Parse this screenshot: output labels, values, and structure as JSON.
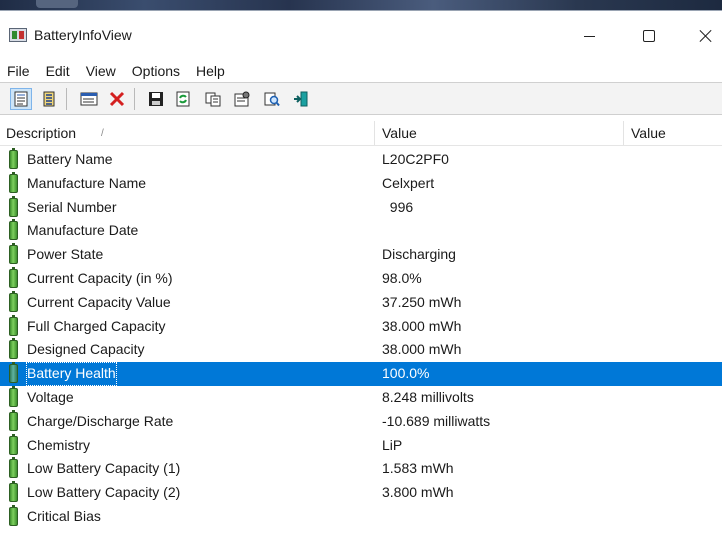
{
  "window": {
    "title": "BatteryInfoView",
    "icon": "battery-info-app-icon"
  },
  "menu": [
    "File",
    "Edit",
    "View",
    "Options",
    "Help"
  ],
  "toolbar": {
    "buttons": [
      "html-report-icon",
      "text-report-icon",
      "properties-window-icon",
      "delete-icon",
      "save-icon",
      "refresh-icon",
      "copy-icon",
      "properties-icon",
      "find-icon",
      "exit-icon"
    ]
  },
  "table": {
    "columns": [
      "Description",
      "Value",
      "Value"
    ],
    "sort_indicator": "/",
    "rows": [
      {
        "desc": "Battery Name",
        "value": "L20C2PF0"
      },
      {
        "desc": "Manufacture Name",
        "value": "Celxpert"
      },
      {
        "desc": "Serial Number",
        "value": "  996"
      },
      {
        "desc": "Manufacture Date",
        "value": ""
      },
      {
        "desc": "Power State",
        "value": "Discharging"
      },
      {
        "desc": "Current Capacity (in %)",
        "value": "98.0%"
      },
      {
        "desc": "Current Capacity Value",
        "value": "37.250 mWh"
      },
      {
        "desc": "Full Charged Capacity",
        "value": "38.000 mWh"
      },
      {
        "desc": "Designed Capacity",
        "value": "38.000 mWh"
      },
      {
        "desc": "Battery Health",
        "value": "100.0%",
        "selected": true
      },
      {
        "desc": "Voltage",
        "value": "8.248 millivolts"
      },
      {
        "desc": "Charge/Discharge Rate",
        "value": "-10.689 milliwatts"
      },
      {
        "desc": "Chemistry",
        "value": "LiP"
      },
      {
        "desc": "Low Battery Capacity (1)",
        "value": "1.583 mWh"
      },
      {
        "desc": "Low Battery Capacity (2)",
        "value": "3.800 mWh"
      },
      {
        "desc": "Critical Bias",
        "value": ""
      }
    ]
  },
  "colors": {
    "selection": "#0078d7",
    "battery_green": "#3c8f2c"
  }
}
